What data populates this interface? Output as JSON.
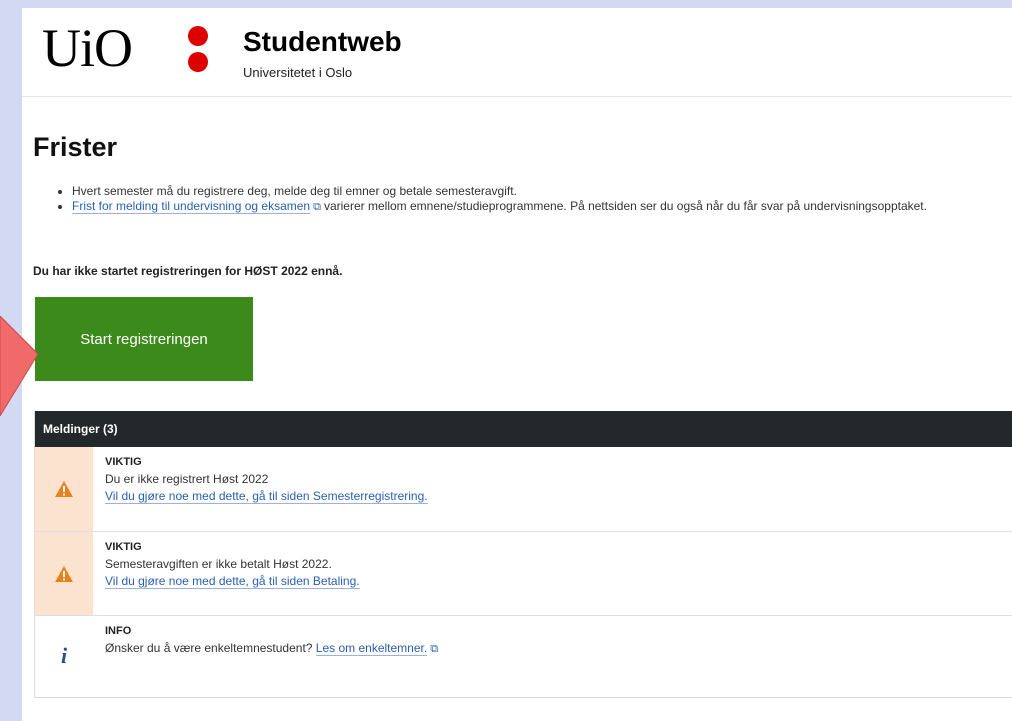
{
  "header": {
    "logo_text": "UiO",
    "app_title": "Studentweb",
    "app_subtitle": "Universitetet i Oslo",
    "brand_color": "#dd0000"
  },
  "main": {
    "title": "Frister",
    "bullets": [
      {
        "text": "Hvert semester må du registrere deg, melde deg til emner og betale semesteravgift."
      },
      {
        "link": "Frist for melding til undervisning og eksamen",
        "rest": "varierer mellom emnene/studieprogrammene. På nettsiden ser du også når du får svar på undervisningsopptaket."
      }
    ],
    "status": "Du har ikke startet registreringen for HØST 2022 ennå.",
    "start_button": "Start registreringen",
    "button_color": "#3c8a1c"
  },
  "messages": {
    "header": "Meldinger (3)",
    "items": [
      {
        "kind": "VIKTIG",
        "text": "Du er ikke registrert Høst 2022",
        "link": "Vil du gjøre noe med dette, gå til siden Semesterregistrering.",
        "icon": "warning-icon"
      },
      {
        "kind": "VIKTIG",
        "text": "Semesteravgiften er ikke betalt Høst 2022.",
        "link": "Vil du gjøre noe med dette, gå til siden Betaling.",
        "icon": "warning-icon"
      },
      {
        "kind": "INFO",
        "text": "Ønsker du å være enkeltemnestudent?",
        "link": "Les om enkeltemner.",
        "icon": "info-icon"
      }
    ]
  }
}
